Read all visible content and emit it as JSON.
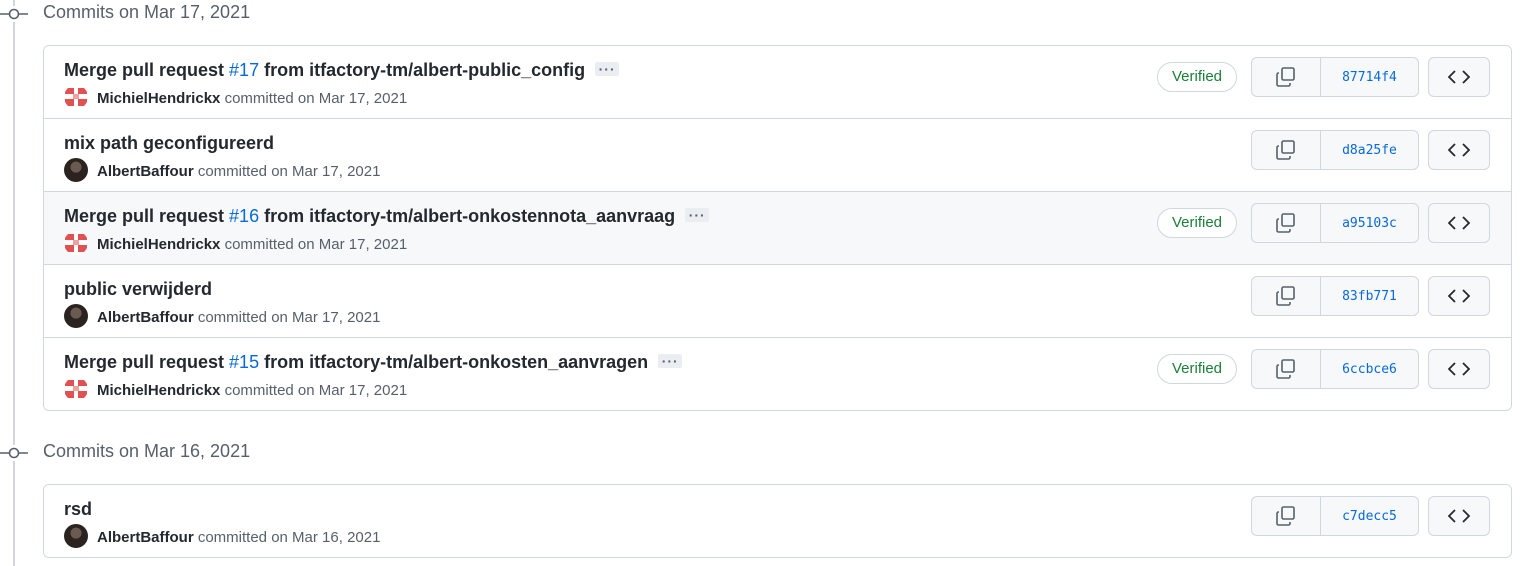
{
  "groups": [
    {
      "date_label": "Commits on Mar 17, 2021",
      "commits": [
        {
          "msg_pre": "Merge pull request ",
          "issue": "#17",
          "msg_post": " from itfactory-tm/albert-public_config",
          "author": "MichielHendrickx",
          "committed_text": "committed on Mar 17, 2021",
          "verified": "Verified",
          "sha": "87714f4"
        },
        {
          "msg_pre": "mix path geconfigureerd",
          "issue": "",
          "msg_post": "",
          "author": "AlbertBaffour",
          "committed_text": "committed on Mar 17, 2021",
          "verified": "",
          "sha": "d8a25fe"
        },
        {
          "msg_pre": "Merge pull request ",
          "issue": "#16",
          "msg_post": " from itfactory-tm/albert-onkostennota_aanvraag",
          "author": "MichielHendrickx",
          "committed_text": "committed on Mar 17, 2021",
          "verified": "Verified",
          "sha": "a95103c"
        },
        {
          "msg_pre": "public verwijderd",
          "issue": "",
          "msg_post": "",
          "author": "AlbertBaffour",
          "committed_text": "committed on Mar 17, 2021",
          "verified": "",
          "sha": "83fb771"
        },
        {
          "msg_pre": "Merge pull request ",
          "issue": "#15",
          "msg_post": " from itfactory-tm/albert-onkosten_aanvragen",
          "author": "MichielHendrickx",
          "committed_text": "committed on Mar 17, 2021",
          "verified": "Verified",
          "sha": "6ccbce6"
        }
      ]
    },
    {
      "date_label": "Commits on Mar 16, 2021",
      "commits": [
        {
          "msg_pre": "rsd",
          "issue": "",
          "msg_post": "",
          "author": "AlbertBaffour",
          "committed_text": "committed on Mar 16, 2021",
          "verified": "",
          "sha": "c7decc5"
        }
      ]
    }
  ],
  "icons": {
    "commit_node": "git-commit-icon",
    "copy": "copy-icon",
    "browse": "code-icon",
    "ellipsis": "kebab-horizontal-icon"
  },
  "colors": {
    "link": "#0969da",
    "verified": "#1a7f37",
    "border": "#d0d7de"
  }
}
